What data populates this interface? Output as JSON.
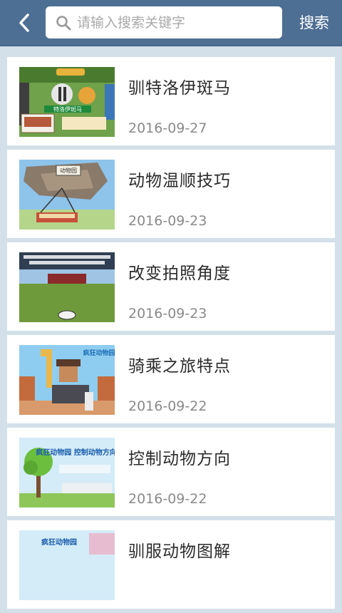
{
  "header": {
    "back_icon": "chevron-left-icon",
    "search_icon": "search-icon",
    "search_placeholder": "请输入搜索关键字",
    "search_value": "",
    "search_button_label": "搜索",
    "bar_color": "#4e6f94"
  },
  "articles": [
    {
      "title": "驯特洛伊斑马",
      "date": "2016-09-27",
      "thumb_text": "特洛伊斑马"
    },
    {
      "title": "动物温顺技巧",
      "date": "2016-09-23",
      "thumb_text": "动物园"
    },
    {
      "title": "改变拍照角度",
      "date": "2016-09-23",
      "thumb_text": ""
    },
    {
      "title": "骑乘之旅特点",
      "date": "2016-09-22",
      "thumb_text": "疯狂动物园"
    },
    {
      "title": "控制动物方向",
      "date": "2016-09-22",
      "thumb_text": "疯狂动物园 控制动物方向技巧"
    },
    {
      "title": "驯服动物图解",
      "date": "",
      "thumb_text": "疯狂动物园"
    }
  ]
}
